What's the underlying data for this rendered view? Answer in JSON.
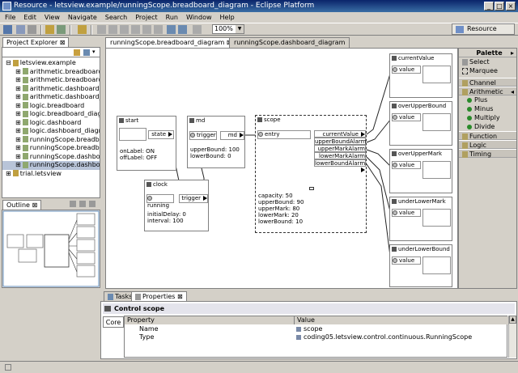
{
  "window": {
    "title": "Resource - letsview.example/runningScope.breadboard_diagram - Eclipse Platform"
  },
  "menu": [
    "File",
    "Edit",
    "View",
    "Navigate",
    "Search",
    "Project",
    "Run",
    "Window",
    "Help"
  ],
  "toolbar": {
    "zoom": "100%",
    "perspective": "Resource"
  },
  "project_explorer": {
    "tab": "Project Explorer",
    "items": [
      {
        "label": "letsview.example",
        "level": 0
      },
      {
        "label": "arithmetic.breadboard",
        "level": 1
      },
      {
        "label": "arithmetic.breadboard_d",
        "level": 1
      },
      {
        "label": "arithmetic.dashboard",
        "level": 1
      },
      {
        "label": "arithmetic.dashboard_d",
        "level": 1
      },
      {
        "label": "logic.breadboard",
        "level": 1
      },
      {
        "label": "logic.breadboard_diag",
        "level": 1
      },
      {
        "label": "logic.dashboard",
        "level": 1
      },
      {
        "label": "logic.dashboard_diagr",
        "level": 1
      },
      {
        "label": "runningScope.breadbo",
        "level": 1
      },
      {
        "label": "runningScope.breadbo",
        "level": 1
      },
      {
        "label": "runningScope.dashboa",
        "level": 1
      },
      {
        "label": "runningScope.dashboa",
        "level": 1
      },
      {
        "label": "trial.letsview",
        "level": 0
      }
    ]
  },
  "outline": {
    "tab": "Outline"
  },
  "editor": {
    "tabs": [
      "runningScope.breadboard_diagram",
      "runningScope.dashboard_diagram"
    ]
  },
  "diagram": {
    "start": {
      "title": "start",
      "port": "state",
      "attrs": [
        "onLabel: ON",
        "offLabel: OFF"
      ]
    },
    "md": {
      "title": "md",
      "in": "trigger",
      "out": "md",
      "attrs": [
        "upperBound: 100",
        "lowerBound: 0"
      ]
    },
    "clock": {
      "title": "clock",
      "in": "running",
      "out": "trigger",
      "attrs": [
        "initialDelay: 0",
        "interval: 100"
      ]
    },
    "scope": {
      "title": "scope",
      "in": "entry",
      "outs": [
        "currentValue",
        "upperBoundAlarm",
        "upperMarkAlarm",
        "lowerMarkAlarm",
        "lowerBoundAlarm"
      ],
      "attrs": [
        "capacity: 50",
        "upperBound: 90",
        "upperMark: 80",
        "lowerMark: 20",
        "lowerBound: 10"
      ]
    },
    "displays": [
      {
        "title": "currentValue",
        "port": "value"
      },
      {
        "title": "overUpperBound",
        "port": "value"
      },
      {
        "title": "overUpperMark",
        "port": "value"
      },
      {
        "title": "underLowerMark",
        "port": "value"
      },
      {
        "title": "underLowerBound",
        "port": "value"
      }
    ]
  },
  "palette": {
    "title": "Palette",
    "tools": [
      "Select",
      "Marquee"
    ],
    "groups": [
      {
        "label": "Channel",
        "items": []
      },
      {
        "label": "Arithmetic",
        "items": [
          "Plus",
          "Minus",
          "Multiply",
          "Divide"
        ]
      },
      {
        "label": "Function",
        "items": []
      },
      {
        "label": "Logic",
        "items": []
      },
      {
        "label": "Timing",
        "items": []
      }
    ]
  },
  "properties": {
    "tabs": [
      "Tasks",
      "Properties"
    ],
    "header": "Control scope",
    "section": "Core",
    "columns": [
      "Property",
      "Value"
    ],
    "rows": [
      {
        "property": "Name",
        "value": "scope"
      },
      {
        "property": "Type",
        "value": "coding05.letsview.control.continuous.RunningScope"
      }
    ]
  }
}
